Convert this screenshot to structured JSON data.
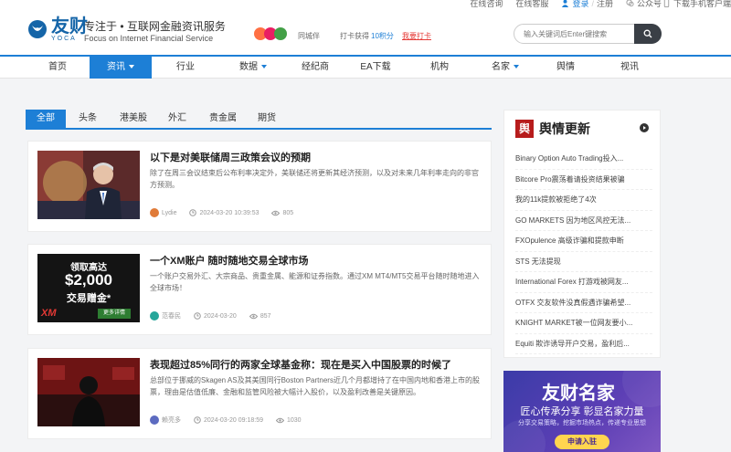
{
  "topbar": {
    "online_consult": "在线咨询",
    "online_service": "在线客服",
    "login": "登录",
    "register": "注册",
    "wechat": "公众号",
    "download_app": "下载手机客户端"
  },
  "header": {
    "logo_cn": "友财",
    "logo_en": "YOCA",
    "tagline_cn": "专注于 • 互联网金融资讯服务",
    "tagline_en": "Focus on Internet Financial Service",
    "checkin_label": "同城伴",
    "points_label": "打卡获得",
    "points_value": "10积分",
    "checkin_link": "我要打卡",
    "search_placeholder": "输入关键词后Enter键搜索"
  },
  "nav": {
    "items": [
      {
        "label": "首页"
      },
      {
        "label": "资讯"
      },
      {
        "label": "行业"
      },
      {
        "label": "数据"
      },
      {
        "label": "经纪商"
      },
      {
        "label": "EA下载"
      },
      {
        "label": "机构"
      },
      {
        "label": "名家"
      },
      {
        "label": "舆情"
      },
      {
        "label": "视讯"
      }
    ]
  },
  "tabs": [
    "全部",
    "头条",
    "港美股",
    "外汇",
    "贵金属",
    "期货"
  ],
  "articles": [
    {
      "title": "以下是对美联储周三政策会议的预期",
      "desc": "除了在周三会议结束后公布利率决定外，美联储还将更新其经济预测，以及对未来几年利率走向的非官方预测。",
      "author": "Lydie",
      "time": "2024-03-20 10:39:53",
      "views": "805"
    },
    {
      "title": "一个XM账户 随时随地交易全球市场",
      "desc": "一个账户交易外汇、大宗商品、贵重金属、能源和证券指数。通过XM MT4/MT5交易平台随时随地进入全球市场！",
      "author": "范春民",
      "time": "2024-03-20",
      "views": "857",
      "ad_line1": "领取高达",
      "ad_line2": "$2,000",
      "ad_line3": "交易赠金*",
      "ad_brand": "XM",
      "ad_btn": "更多详情"
    },
    {
      "title": "表现超过85%同行的两家全球基金称：现在是买入中国股票的时候了",
      "desc": "总部位于挪威的Skagen AS及其美国同行Boston Partners近几个月都增持了在中国内地和香港上市的股票，理由是估值低廉、金融和监管风险被大幅计入股价，以及盈利改善是关键原因。",
      "author": "赖亮多",
      "time": "2024-03-20 09:18:59",
      "views": "1030"
    }
  ],
  "sidebar": {
    "icon_char": "舆",
    "title": "舆情更新",
    "items": [
      "Binary Option Auto Trading投入...",
      "Bitcore Pro震荡着请投资结果被骗",
      "我的11k提款被拒绝了4次",
      "GO MARKETS 因为地区风控无法...",
      "FXOpulence 高级诈骗和提款申断",
      "STS 无法提现",
      "International Forex 打游戏被网友...",
      "OTFX 交友软件没真假遇诈骗希望...",
      "KNIGHT MARKET被一位网友要小...",
      "Equiti 欺诈诱导开户交易，盈利后..."
    ]
  },
  "promo": {
    "title": "友财名家",
    "subtitle": "匠心传承分享  彰显名家力量",
    "subtitle2": "分享交易策略，挖掘市场热点，传递专业思想",
    "button": "申请入驻"
  },
  "colors": {
    "primary": "#1d7fd6",
    "checkin_link": "#e53935",
    "points": "#1d7fd6"
  }
}
